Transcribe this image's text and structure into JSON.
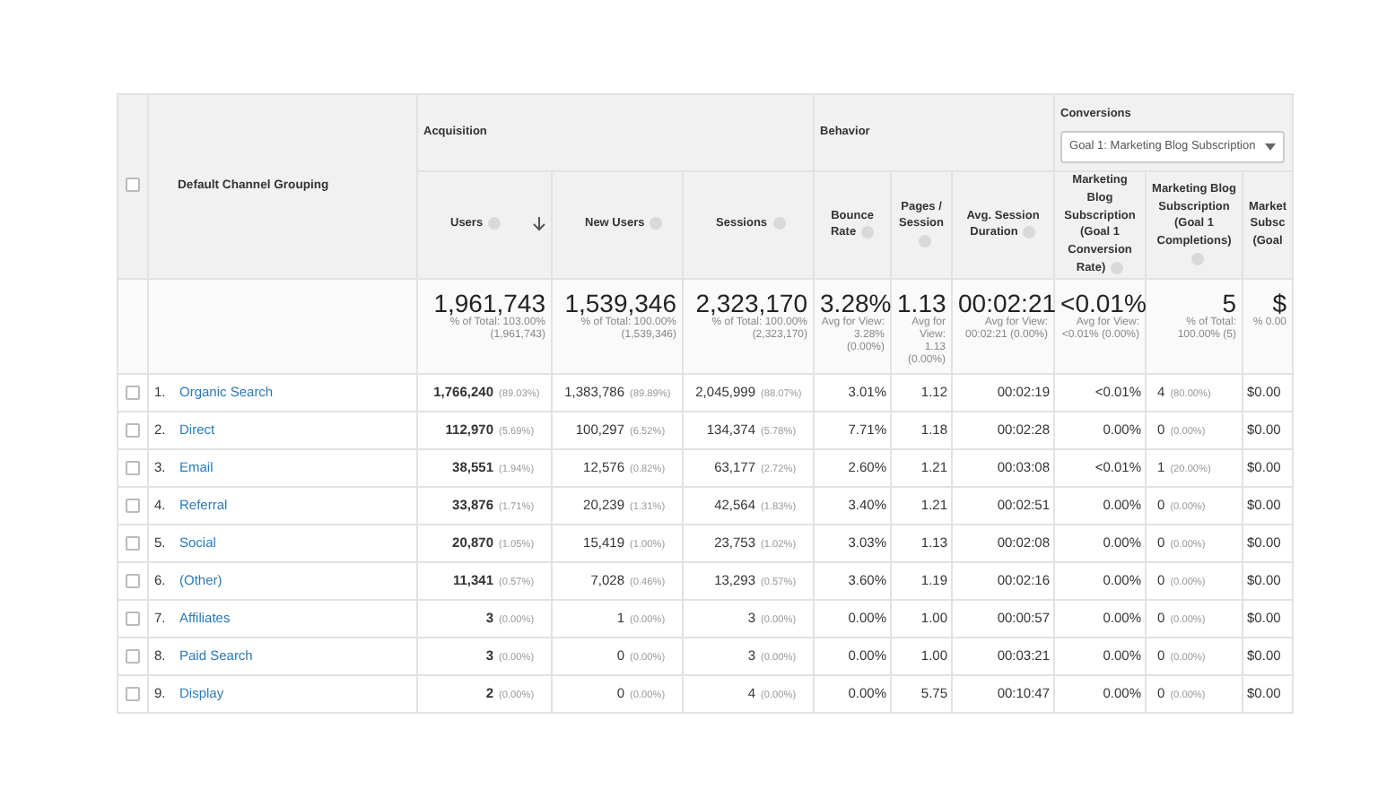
{
  "table": {
    "select_all": {
      "checked": false
    },
    "dimension_header": "Default Channel Grouping",
    "groups": [
      {
        "label": "Acquisition",
        "columns": [
          {
            "label": "Users",
            "help_icon": true,
            "sorted": true,
            "bold": true
          },
          {
            "label": "New Users",
            "help_icon": true,
            "sorted": false,
            "bold": false
          },
          {
            "label": "Sessions",
            "help_icon": true,
            "sorted": false,
            "bold": false
          }
        ]
      },
      {
        "label": "Behavior",
        "columns": [
          {
            "label": "Bounce Rate",
            "help_icon": true,
            "sorted": false,
            "bold": false
          },
          {
            "label": "Pages / Session",
            "help_icon": true,
            "sorted": false,
            "bold": false
          },
          {
            "label": "Avg. Session Duration",
            "help_icon": true,
            "sorted": false,
            "bold": false
          }
        ]
      },
      {
        "label": "Conversions",
        "dropdown": "Goal 1: Marketing Blog Subscription",
        "columns": [
          {
            "label": "Marketing Blog Subscription (Goal 1 Conversion Rate)",
            "help_icon": true,
            "sorted": false,
            "bold": false
          },
          {
            "label": "Marketing Blog Subscription (Goal 1 Completions)",
            "help_icon": true,
            "sorted": false,
            "bold": false
          },
          {
            "label": "Market Subsc (Goal",
            "help_icon": false,
            "sorted": false,
            "bold": false
          }
        ]
      }
    ],
    "totals": [
      {
        "value": "1,961,743",
        "note": "% of Total: 103.00% (1,961,743)"
      },
      {
        "value": "1,539,346",
        "note": "% of Total: 100.00% (1,539,346)"
      },
      {
        "value": "2,323,170",
        "note": "% of Total: 100.00% (2,323,170)"
      },
      {
        "value": "3.28%",
        "note": "Avg for View: 3.28% (0.00%)"
      },
      {
        "value": "1.13",
        "note": "Avg for View: 1.13 (0.00%)"
      },
      {
        "value": "00:02:21",
        "note": "Avg for View: 00:02:21 (0.00%)"
      },
      {
        "value": "<0.01%",
        "note": "Avg for View: <0.01% (0.00%)"
      },
      {
        "value": "5",
        "note": "% of Total: 100.00% (5)"
      },
      {
        "value": "$",
        "note": "% 0.00"
      }
    ],
    "rows": [
      {
        "number": "1.",
        "channel": "Organic Search",
        "checked": false,
        "cells": [
          {
            "value": "1,766,240",
            "share": "(89.03%)"
          },
          {
            "value": "1,383,786",
            "share": "(89.89%)"
          },
          {
            "value": "2,045,999",
            "share": "(88.07%)"
          },
          {
            "value": "3.01%"
          },
          {
            "value": "1.12"
          },
          {
            "value": "00:02:19"
          },
          {
            "value": "<0.01%"
          },
          {
            "value": "4",
            "share": "(80.00%)"
          },
          {
            "value": "$0.00"
          }
        ]
      },
      {
        "number": "2.",
        "channel": "Direct",
        "checked": false,
        "cells": [
          {
            "value": "112,970",
            "share": "(5.69%)"
          },
          {
            "value": "100,297",
            "share": "(6.52%)"
          },
          {
            "value": "134,374",
            "share": "(5.78%)"
          },
          {
            "value": "7.71%"
          },
          {
            "value": "1.18"
          },
          {
            "value": "00:02:28"
          },
          {
            "value": "0.00%"
          },
          {
            "value": "0",
            "share": "(0.00%)"
          },
          {
            "value": "$0.00"
          }
        ]
      },
      {
        "number": "3.",
        "channel": "Email",
        "checked": false,
        "cells": [
          {
            "value": "38,551",
            "share": "(1.94%)"
          },
          {
            "value": "12,576",
            "share": "(0.82%)"
          },
          {
            "value": "63,177",
            "share": "(2.72%)"
          },
          {
            "value": "2.60%"
          },
          {
            "value": "1.21"
          },
          {
            "value": "00:03:08"
          },
          {
            "value": "<0.01%"
          },
          {
            "value": "1",
            "share": "(20.00%)"
          },
          {
            "value": "$0.00"
          }
        ]
      },
      {
        "number": "4.",
        "channel": "Referral",
        "checked": false,
        "cells": [
          {
            "value": "33,876",
            "share": "(1.71%)"
          },
          {
            "value": "20,239",
            "share": "(1.31%)"
          },
          {
            "value": "42,564",
            "share": "(1.83%)"
          },
          {
            "value": "3.40%"
          },
          {
            "value": "1.21"
          },
          {
            "value": "00:02:51"
          },
          {
            "value": "0.00%"
          },
          {
            "value": "0",
            "share": "(0.00%)"
          },
          {
            "value": "$0.00"
          }
        ]
      },
      {
        "number": "5.",
        "channel": "Social",
        "checked": false,
        "cells": [
          {
            "value": "20,870",
            "share": "(1.05%)"
          },
          {
            "value": "15,419",
            "share": "(1.00%)"
          },
          {
            "value": "23,753",
            "share": "(1.02%)"
          },
          {
            "value": "3.03%"
          },
          {
            "value": "1.13"
          },
          {
            "value": "00:02:08"
          },
          {
            "value": "0.00%"
          },
          {
            "value": "0",
            "share": "(0.00%)"
          },
          {
            "value": "$0.00"
          }
        ]
      },
      {
        "number": "6.",
        "channel": "(Other)",
        "checked": false,
        "cells": [
          {
            "value": "11,341",
            "share": "(0.57%)"
          },
          {
            "value": "7,028",
            "share": "(0.46%)"
          },
          {
            "value": "13,293",
            "share": "(0.57%)"
          },
          {
            "value": "3.60%"
          },
          {
            "value": "1.19"
          },
          {
            "value": "00:02:16"
          },
          {
            "value": "0.00%"
          },
          {
            "value": "0",
            "share": "(0.00%)"
          },
          {
            "value": "$0.00"
          }
        ]
      },
      {
        "number": "7.",
        "channel": "Affiliates",
        "checked": false,
        "cells": [
          {
            "value": "3",
            "share": "(0.00%)"
          },
          {
            "value": "1",
            "share": "(0.00%)"
          },
          {
            "value": "3",
            "share": "(0.00%)"
          },
          {
            "value": "0.00%"
          },
          {
            "value": "1.00"
          },
          {
            "value": "00:00:57"
          },
          {
            "value": "0.00%"
          },
          {
            "value": "0",
            "share": "(0.00%)"
          },
          {
            "value": "$0.00"
          }
        ]
      },
      {
        "number": "8.",
        "channel": "Paid Search",
        "checked": false,
        "cells": [
          {
            "value": "3",
            "share": "(0.00%)"
          },
          {
            "value": "0",
            "share": "(0.00%)"
          },
          {
            "value": "3",
            "share": "(0.00%)"
          },
          {
            "value": "0.00%"
          },
          {
            "value": "1.00"
          },
          {
            "value": "00:03:21"
          },
          {
            "value": "0.00%"
          },
          {
            "value": "0",
            "share": "(0.00%)"
          },
          {
            "value": "$0.00"
          }
        ]
      },
      {
        "number": "9.",
        "channel": "Display",
        "checked": false,
        "cells": [
          {
            "value": "2",
            "share": "(0.00%)"
          },
          {
            "value": "0",
            "share": "(0.00%)"
          },
          {
            "value": "4",
            "share": "(0.00%)"
          },
          {
            "value": "0.00%"
          },
          {
            "value": "5.75"
          },
          {
            "value": "00:10:47"
          },
          {
            "value": "0.00%"
          },
          {
            "value": "0",
            "share": "(0.00%)"
          },
          {
            "value": "$0.00"
          }
        ]
      }
    ]
  }
}
